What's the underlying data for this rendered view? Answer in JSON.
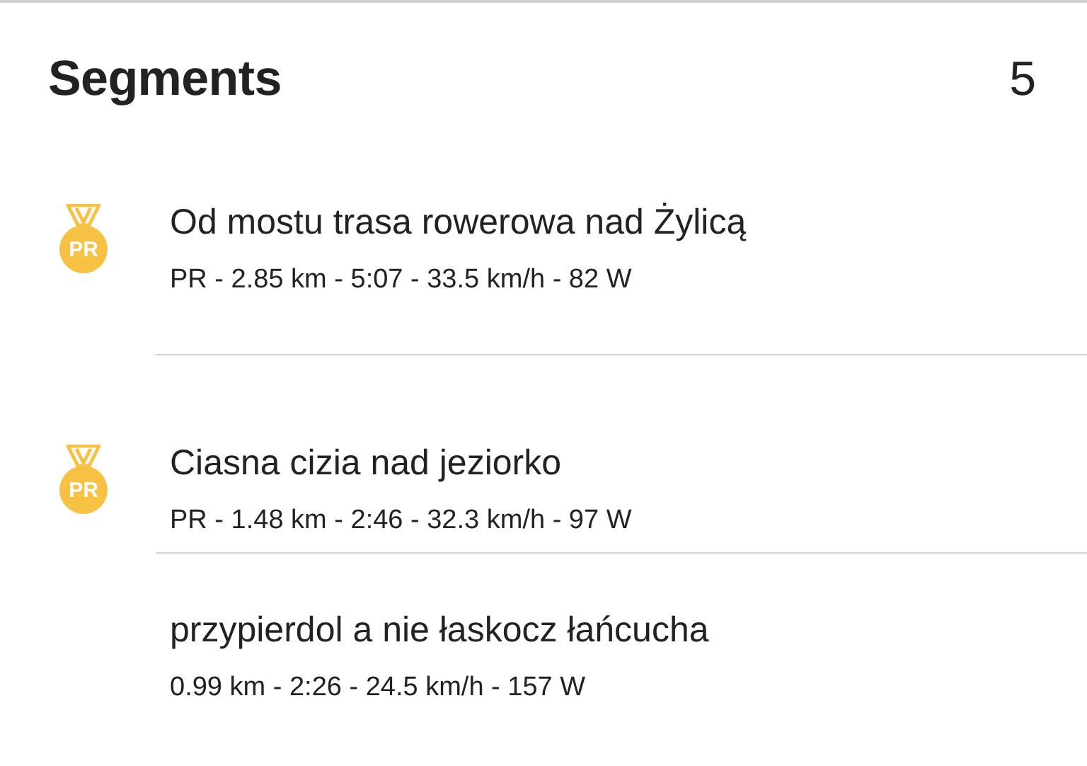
{
  "header": {
    "title": "Segments",
    "count": "5"
  },
  "segments": [
    {
      "name": "Od mostu trasa rowerowa nad Żylicą",
      "stats": "PR - 2.85 km - 5:07 - 33.5 km/h - 82 W",
      "badge": "PR"
    },
    {
      "name": "Ciasna cizia nad jeziorko",
      "stats": "PR - 1.48 km - 2:46 - 32.3 km/h - 97 W",
      "badge": "PR"
    },
    {
      "name": "przypierdol a nie łaskocz łańcucha",
      "stats": "0.99 km - 2:26 - 24.5 km/h - 157 W"
    }
  ]
}
